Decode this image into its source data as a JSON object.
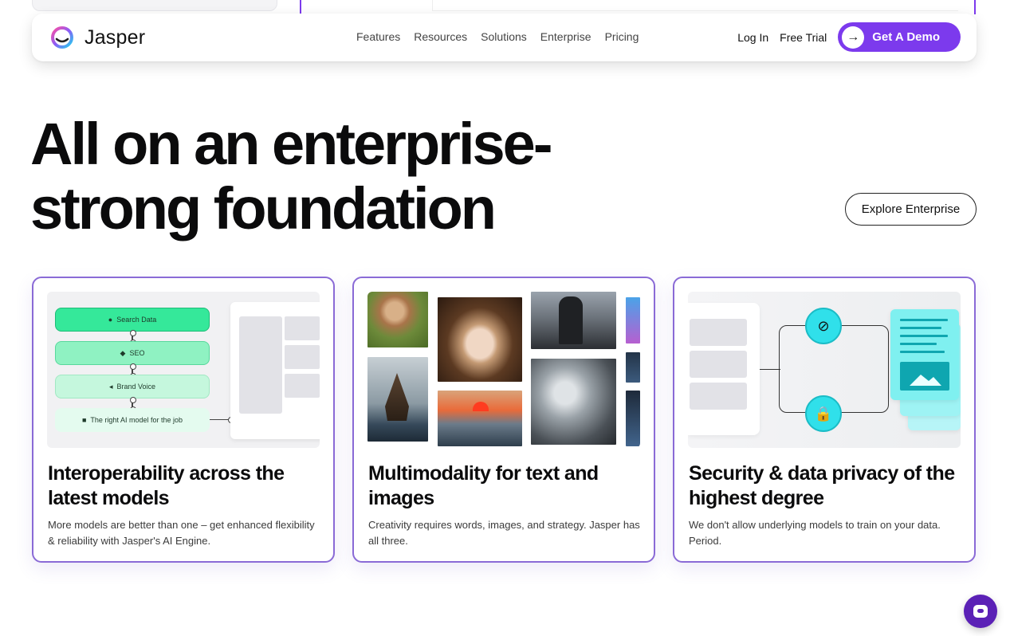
{
  "brand": {
    "name": "Jasper"
  },
  "nav": {
    "links": [
      "Features",
      "Resources",
      "Solutions",
      "Enterprise",
      "Pricing"
    ],
    "login": "Log In",
    "trial": "Free Trial",
    "demo": "Get A Demo"
  },
  "hero": {
    "title": "All on an enterprise-strong foundation",
    "explore": "Explore Enterprise"
  },
  "cards": [
    {
      "title": "Interoperability across the latest models",
      "desc": "More models are better than one – get enhanced flexibility & reliability with Jasper's AI Engine.",
      "flow": [
        "Search Data",
        "SEO",
        "Brand Voice",
        "The right AI model for the job"
      ]
    },
    {
      "title": "Multimodality for text and images",
      "desc": "Creativity requires words, images, and strategy. Jasper has all three."
    },
    {
      "title": "Security & data privacy of the highest degree",
      "desc": "We don't allow underlying models to train on your data. Period."
    }
  ],
  "colors": {
    "accent": "#7c3aed",
    "card_border": "#8a6ad6",
    "mint": "#35e89a",
    "cyan": "#30e0ea"
  }
}
